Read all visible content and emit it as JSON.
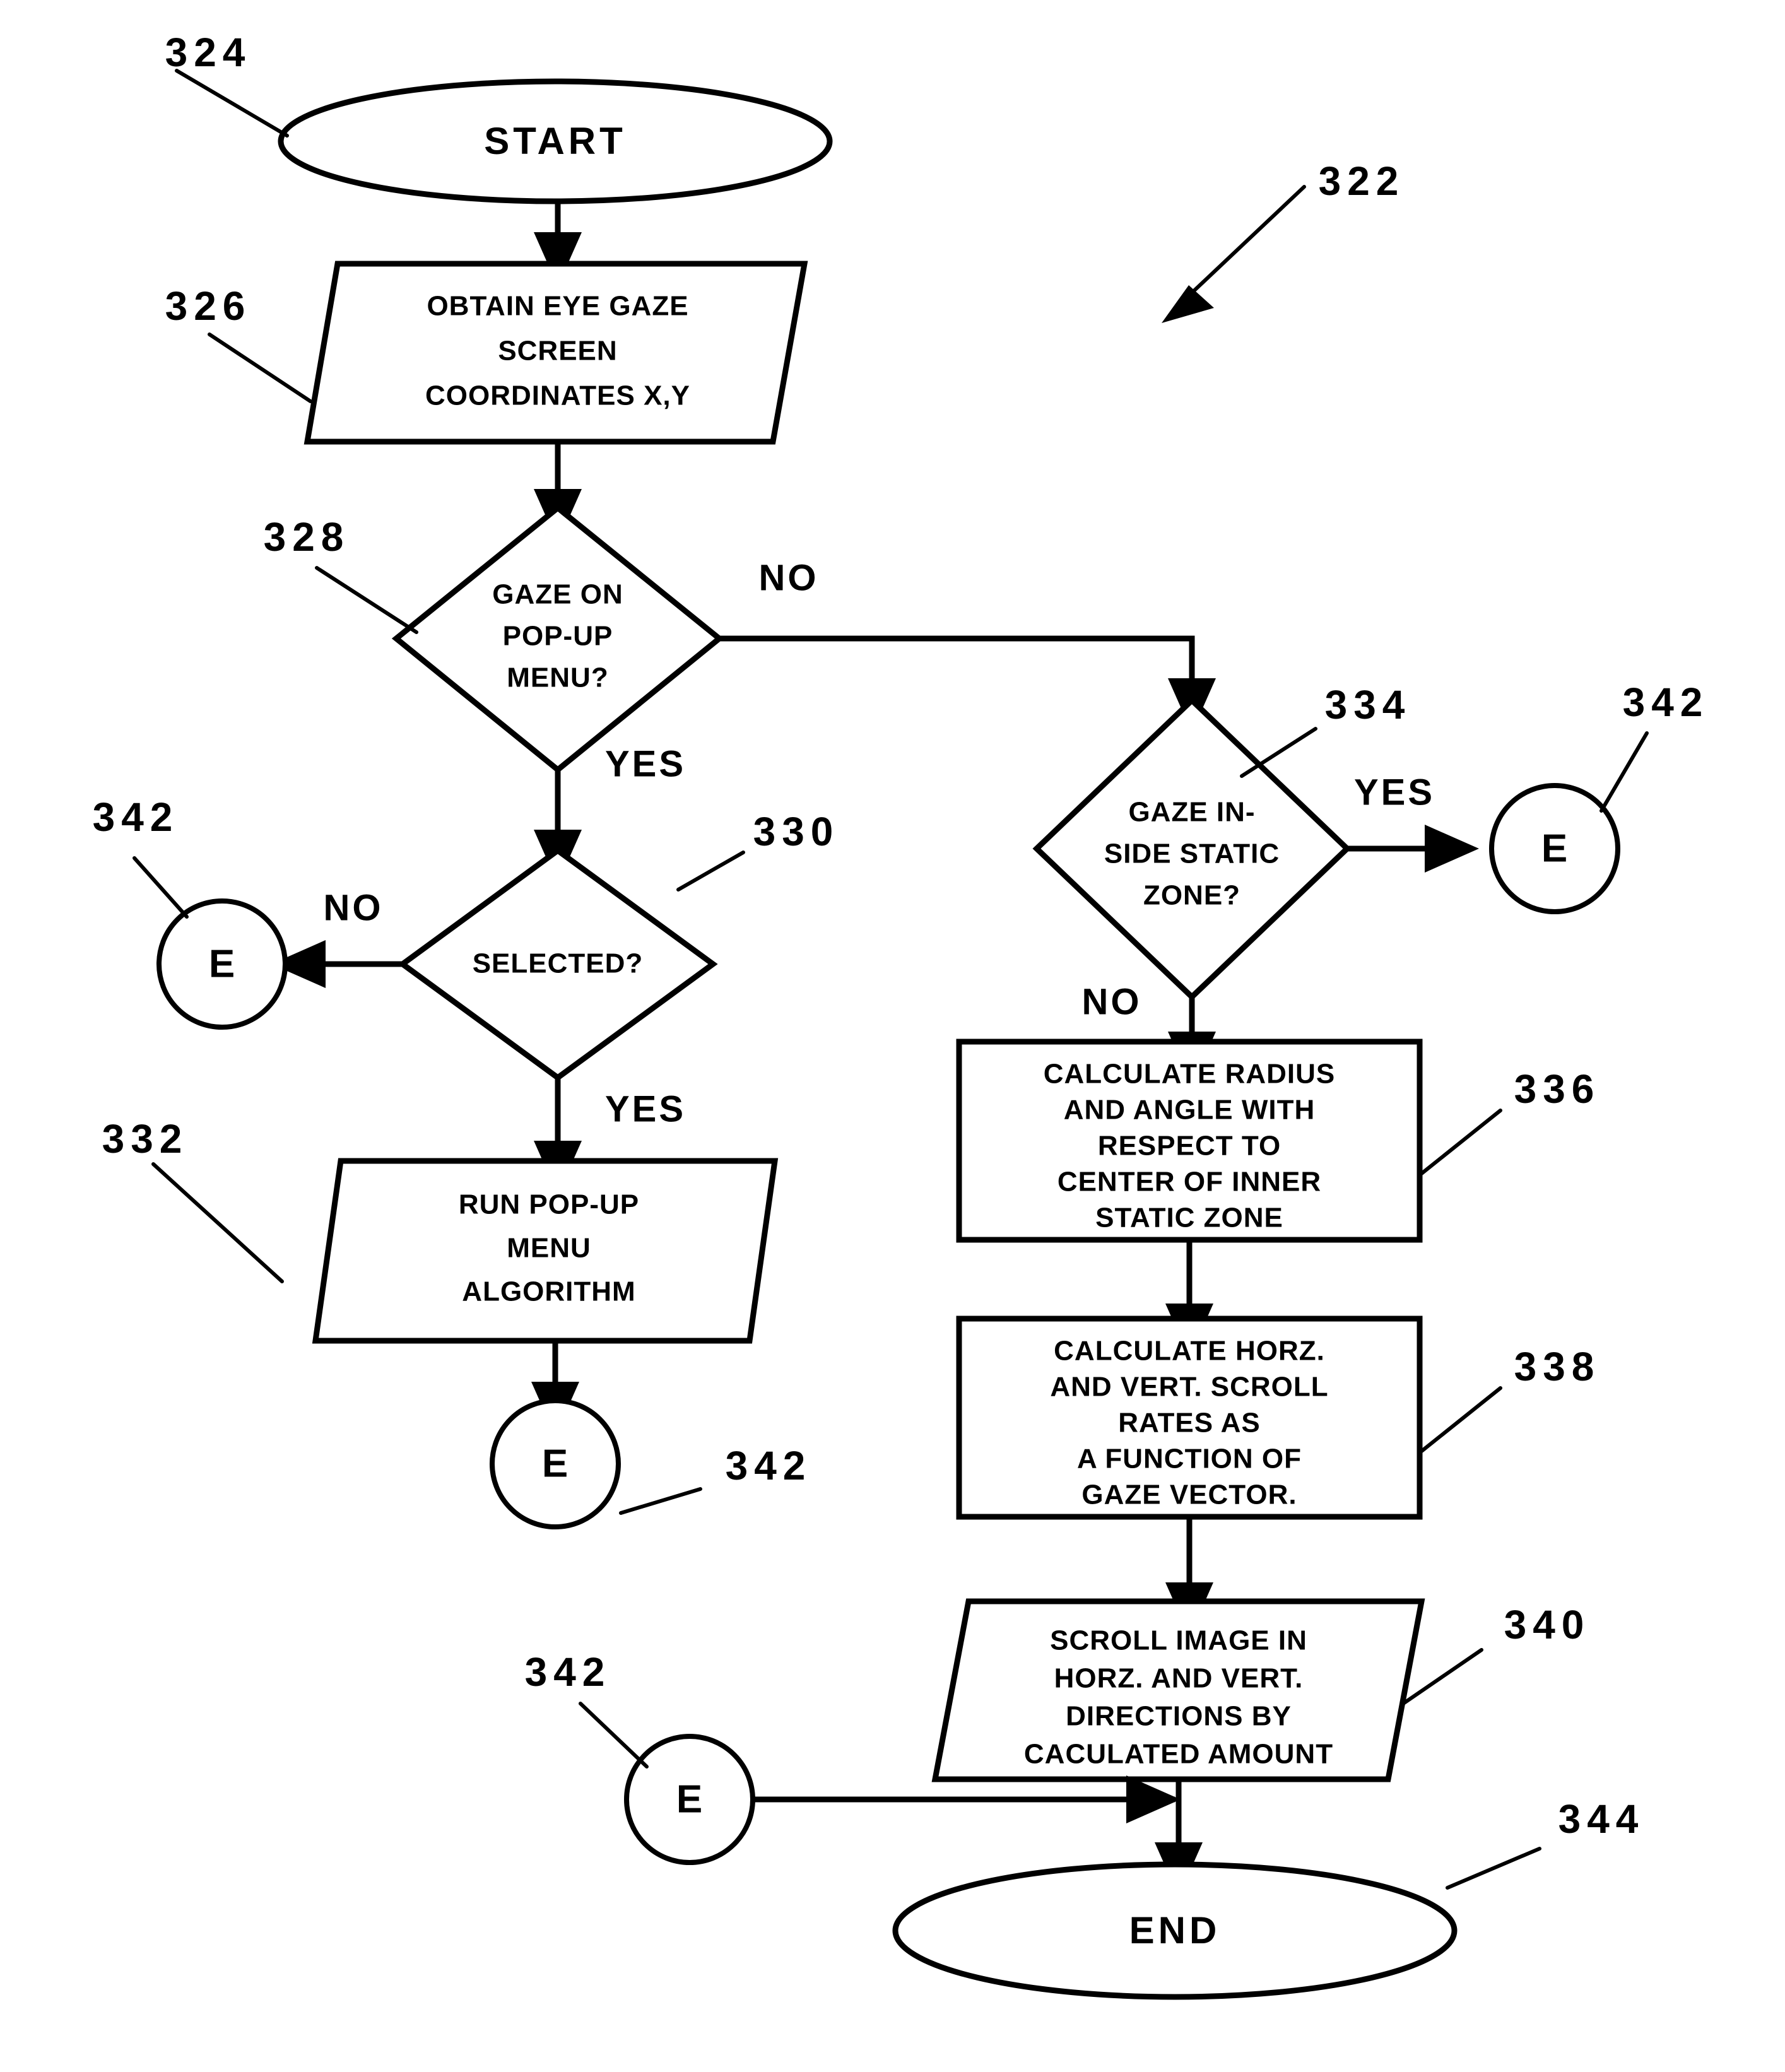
{
  "figure": {
    "type": "patent-flowchart",
    "overall_ref": "322"
  },
  "nodes": {
    "start": {
      "ref": "324",
      "label": "START",
      "shape": "terminator-ellipse"
    },
    "obtain": {
      "ref": "326",
      "shape": "parallelogram",
      "lines": [
        "OBTAIN EYE GAZE",
        "SCREEN",
        "COORDINATES  X,Y"
      ]
    },
    "gaze_popup": {
      "ref": "328",
      "shape": "decision-diamond",
      "lines": [
        "GAZE ON",
        "POP-UP",
        "MENU?"
      ]
    },
    "selected": {
      "ref": "330",
      "shape": "decision-diamond",
      "lines": [
        "SELECTED?"
      ]
    },
    "run_popup": {
      "ref": "332",
      "shape": "parallelogram",
      "lines": [
        "RUN POP-UP",
        "MENU",
        "ALGORITHM"
      ]
    },
    "static_zone": {
      "ref": "334",
      "shape": "decision-diamond",
      "lines": [
        "GAZE IN-",
        "SIDE  STATIC",
        "ZONE?"
      ]
    },
    "calc_radius": {
      "ref": "336",
      "shape": "process-rect",
      "lines": [
        "CALCULATE  RADIUS",
        "AND ANGLE WITH",
        "RESPECT TO",
        "CENTER  OF  INNER",
        "STATIC ZONE"
      ]
    },
    "calc_rates": {
      "ref": "338",
      "shape": "process-rect",
      "lines": [
        "CALCULATE HORZ.",
        "AND VERT. SCROLL",
        "RATES AS",
        "A FUNCTION OF",
        "GAZE VECTOR."
      ]
    },
    "scroll_image": {
      "ref": "340",
      "shape": "parallelogram",
      "lines": [
        "SCROLL IMAGE IN",
        "HORZ. AND VERT.",
        "DIRECTIONS BY",
        "CACULATED  AMOUNT"
      ]
    },
    "end": {
      "ref": "344",
      "label": "END",
      "shape": "terminator-ellipse"
    }
  },
  "connectors": {
    "label": "E",
    "ref": "342",
    "instances": [
      "left-from-selected-no",
      "below-run-popup",
      "right-from-static-zone-yes",
      "bottom-into-end"
    ]
  },
  "edge_labels": {
    "popup_no": "NO",
    "popup_yes": "YES",
    "selected_no": "NO",
    "selected_yes": "YES",
    "static_yes": "YES",
    "static_no": "NO"
  },
  "ref_numbers": {
    "n322": "322",
    "n324": "324",
    "n326": "326",
    "n328": "328",
    "n330": "330",
    "n332": "332",
    "n334": "334",
    "n336": "336",
    "n338": "338",
    "n340": "340",
    "n342_a": "342",
    "n342_b": "342",
    "n342_c": "342",
    "n342_d": "342",
    "n344": "344"
  },
  "colors": {
    "ink": "#000000",
    "paper": "#ffffff"
  }
}
